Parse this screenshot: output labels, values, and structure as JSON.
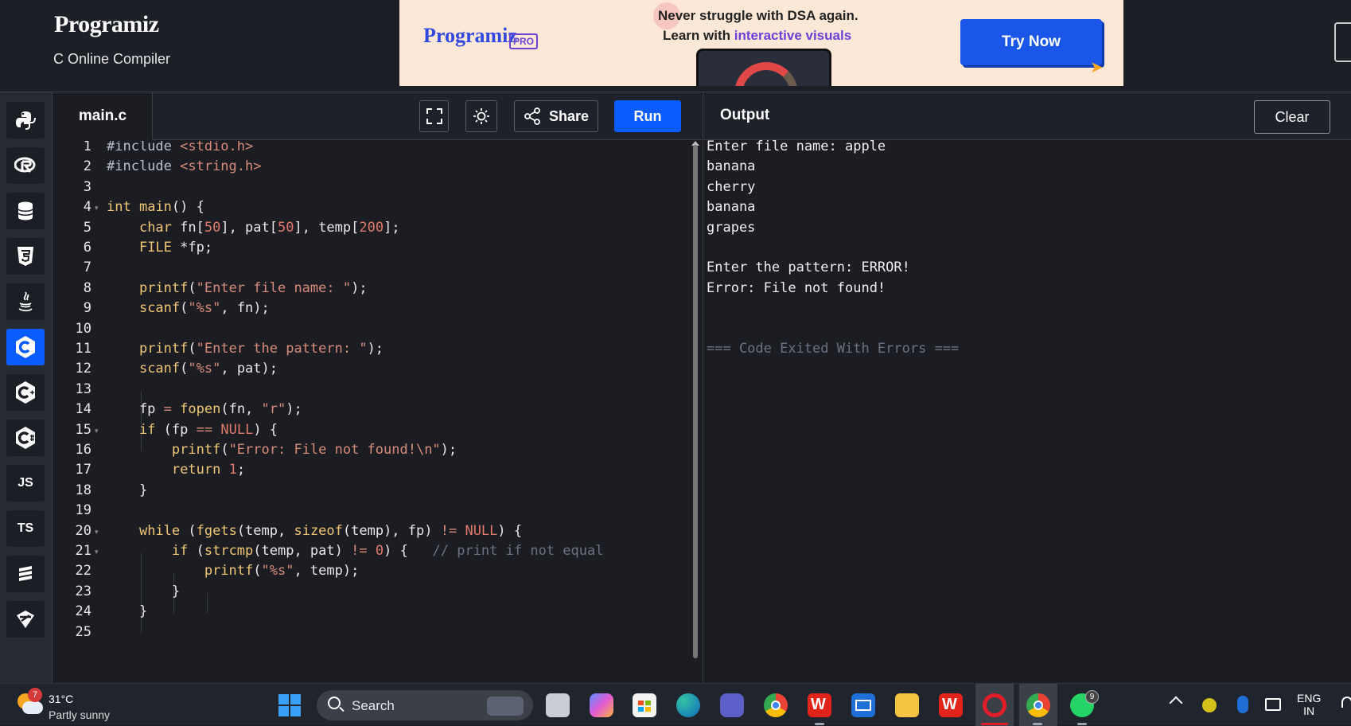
{
  "header": {
    "logo_text": "Programiz",
    "subtitle": "C Online Compiler"
  },
  "ad": {
    "logo_text": "Programiz",
    "pro_label": "PRO",
    "line1": "Never struggle with DSA again.",
    "line2_prefix": "Learn with ",
    "line2_highlight": "interactive visuals",
    "cta_label": "Try Now"
  },
  "sidebar": {
    "items": [
      {
        "icon": "python-icon"
      },
      {
        "icon": "r-icon"
      },
      {
        "icon": "sql-icon"
      },
      {
        "icon": "html-icon"
      },
      {
        "icon": "java-icon"
      },
      {
        "icon": "c-icon",
        "active": true
      },
      {
        "icon": "cpp-icon"
      },
      {
        "icon": "csharp-icon"
      },
      {
        "icon": "js-icon",
        "label": "JS"
      },
      {
        "icon": "ts-icon",
        "label": "TS"
      },
      {
        "icon": "swift-icon"
      },
      {
        "icon": "go-icon"
      }
    ]
  },
  "editor": {
    "tab_label": "main.c",
    "share_label": "Share",
    "run_label": "Run",
    "line_numbers": [
      "1",
      "2",
      "3",
      "4",
      "5",
      "6",
      "7",
      "8",
      "9",
      "10",
      "11",
      "12",
      "13",
      "14",
      "15",
      "16",
      "17",
      "18",
      "19",
      "20",
      "21",
      "22",
      "23",
      "24",
      "25"
    ],
    "lines": [
      "#include <stdio.h>",
      "#include <string.h>",
      "",
      "int main() {",
      "    char fn[50], pat[50], temp[200];",
      "    FILE *fp;",
      "",
      "    printf(\"Enter file name: \");",
      "    scanf(\"%s\", fn);",
      "",
      "    printf(\"Enter the pattern: \");",
      "    scanf(\"%s\", pat);",
      "",
      "    fp = fopen(fn, \"r\");",
      "    if (fp == NULL) {",
      "        printf(\"Error: File not found!\\n\");",
      "        return 1;",
      "    }",
      "",
      "    while (fgets(temp, sizeof(temp), fp) != NULL) {",
      "        if (strcmp(temp, pat) != 0) {   // print if not equal",
      "            printf(\"%s\", temp);",
      "        }",
      "    }",
      ""
    ]
  },
  "output": {
    "title": "Output",
    "clear_label": "Clear",
    "lines": [
      "Enter file name: apple",
      "banana",
      "cherry",
      "banana",
      "grapes",
      "",
      "Enter the pattern: ERROR!",
      "Error: File not found!",
      "",
      "",
      "=== Code Exited With Errors ==="
    ]
  },
  "taskbar": {
    "weather_badge": "7",
    "temperature": "31°C",
    "condition": "Partly sunny",
    "search_label": "Search",
    "whatsapp_badge": "9",
    "lang_line1": "ENG",
    "lang_line2": "IN"
  }
}
